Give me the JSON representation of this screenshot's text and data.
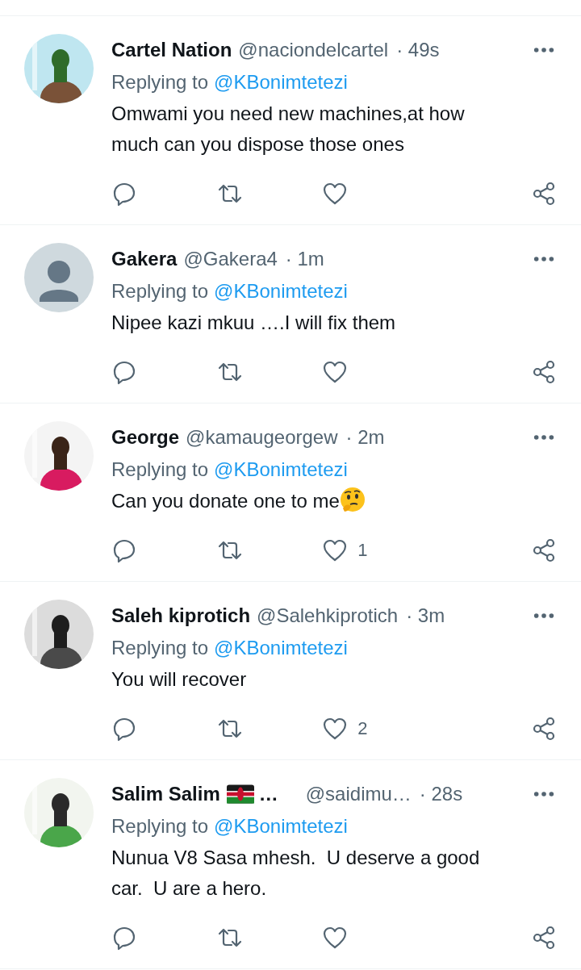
{
  "tweets": [
    {
      "default_avatar": false,
      "name": "Cartel Nation",
      "flag": false,
      "handle": "@naciondelcartel",
      "time": "· 49s",
      "replying_label": "Replying to",
      "replying_to": "@KBonimtetezi",
      "text": "Omwami you need new machines,at how much can you dispose those ones",
      "thinking_emoji": false
    },
    {
      "default_avatar": true,
      "name": "Gakera",
      "flag": false,
      "handle": "@Gakera4",
      "time": "· 1m",
      "replying_label": "Replying to",
      "replying_to": "@KBonimtetezi",
      "text": "Nipee kazi mkuu ….I will fix them",
      "thinking_emoji": false
    },
    {
      "default_avatar": false,
      "name": "George",
      "flag": false,
      "handle": "@kamaugeorgew",
      "time": "· 2m",
      "replying_label": "Replying to",
      "replying_to": "@KBonimtetezi",
      "text": "Can you donate one to me",
      "thinking_emoji": true,
      "likes": "1"
    },
    {
      "default_avatar": false,
      "name": "Saleh kiprotich",
      "flag": false,
      "handle": "@Salehkiprotich",
      "time": "· 3m",
      "replying_label": "Replying to",
      "replying_to": "@KBonimtetezi",
      "text": "You will recover",
      "thinking_emoji": false,
      "likes": "2"
    },
    {
      "default_avatar": false,
      "name": "Salim Salim",
      "flag": true,
      "name_tail": "…",
      "handle": "@saidimu…",
      "time": "· 28s",
      "replying_label": "Replying to",
      "replying_to": "@KBonimtetezi",
      "text": "Nunua V8 Sasa mhesh.  U deserve a good car.  U are a hero.",
      "thinking_emoji": false
    }
  ]
}
